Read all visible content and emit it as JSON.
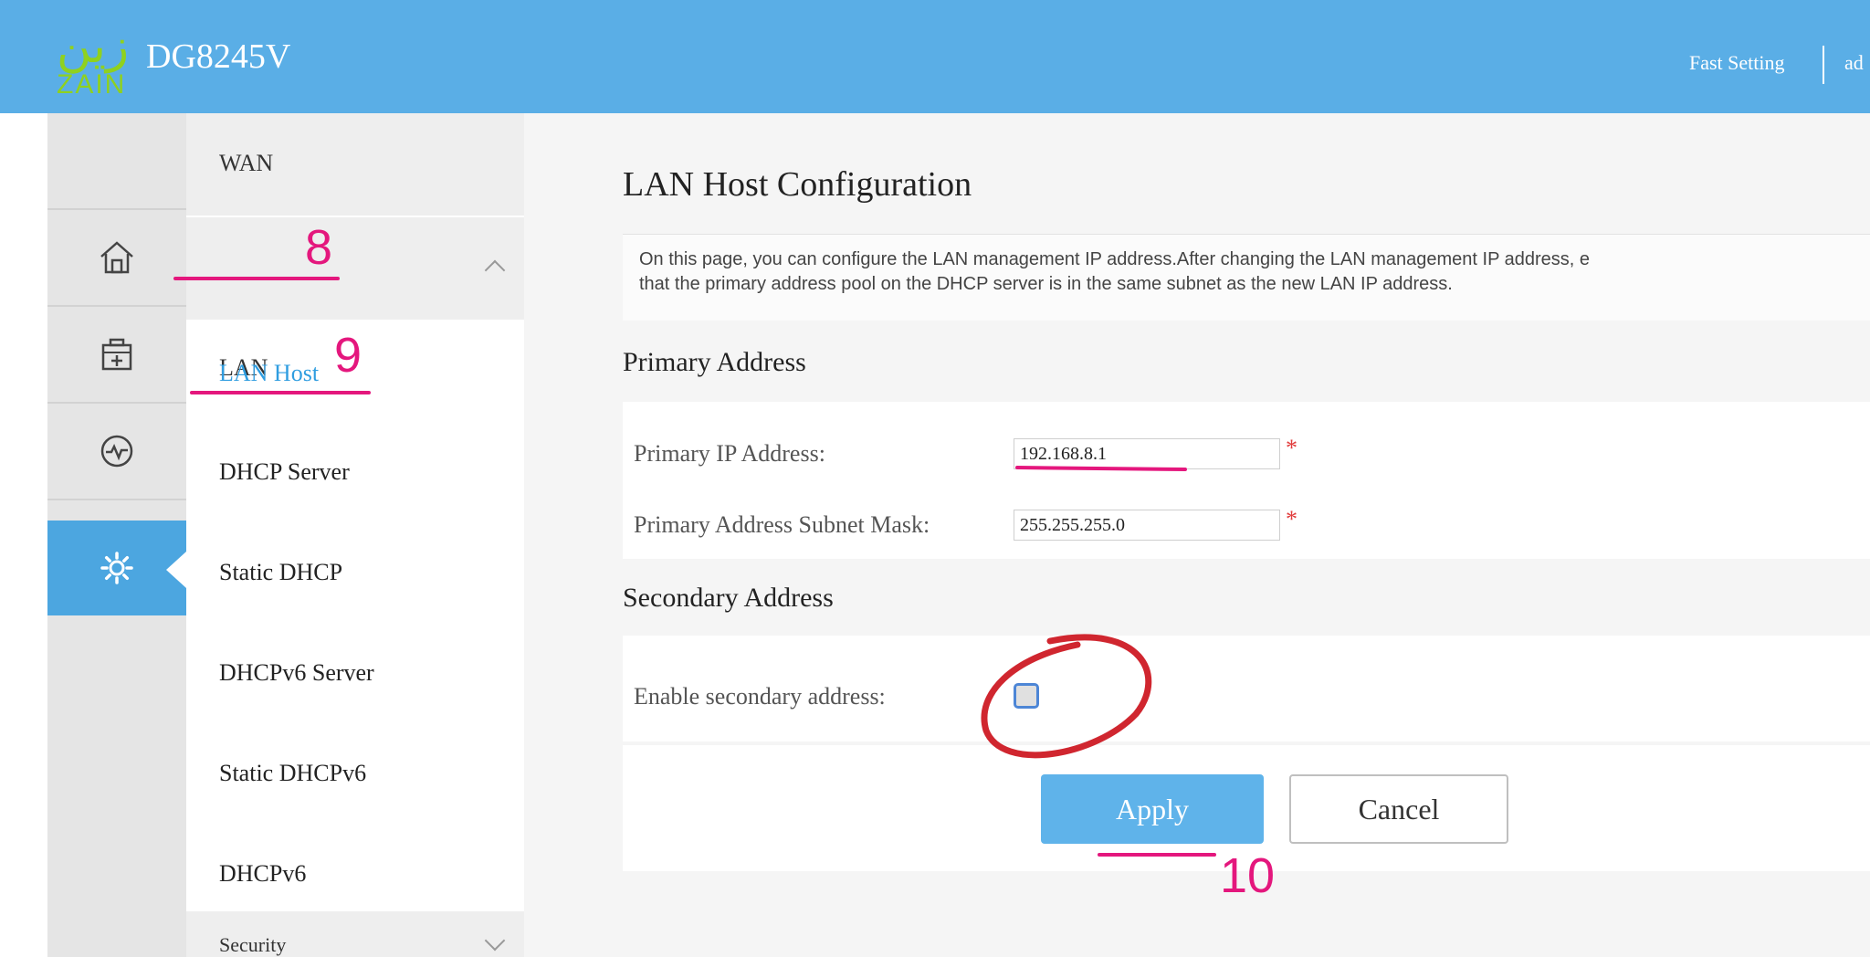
{
  "header": {
    "logo_arabic": "زين",
    "logo_latin": "ZAIN",
    "model": "DG8245V",
    "fast_setting": "Fast Setting",
    "user_partial": "ad"
  },
  "sidebar_icons": [
    {
      "name": "home-icon",
      "active": false
    },
    {
      "name": "medkit-icon",
      "active": false
    },
    {
      "name": "monitor-icon",
      "active": false
    },
    {
      "name": "gear-icon",
      "active": true
    }
  ],
  "submenu": {
    "wan": "WAN",
    "lan": "LAN",
    "items": [
      "LAN Host",
      "DHCP Server",
      "Static DHCP",
      "DHCPv6 Server",
      "Static DHCPv6",
      "DHCPv6"
    ],
    "security_partial": "Security"
  },
  "content": {
    "title": "LAN Host Configuration",
    "description_line1": "On this page, you can configure the LAN management IP address.After changing the LAN management IP address, e",
    "description_line2": "that the primary address pool on the DHCP server is in the same subnet as the new LAN IP address.",
    "primary_title": "Primary Address",
    "primary_ip_label": "Primary IP Address:",
    "primary_ip_value": "192.168.8.1",
    "subnet_label": "Primary Address Subnet Mask:",
    "subnet_value": "255.255.255.0",
    "required_mark": "*",
    "secondary_title": "Secondary Address",
    "enable_secondary_label": "Enable secondary address:",
    "enable_secondary_checked": false,
    "apply": "Apply",
    "cancel": "Cancel"
  },
  "annotations": {
    "step8": "8",
    "step9": "9",
    "step10": "10",
    "pen_color": "#e4177d",
    "circle_color": "#d0262f"
  },
  "colors": {
    "header": "#5aaee6",
    "accent": "#4ca6e0",
    "active_link": "#2f9de0"
  }
}
